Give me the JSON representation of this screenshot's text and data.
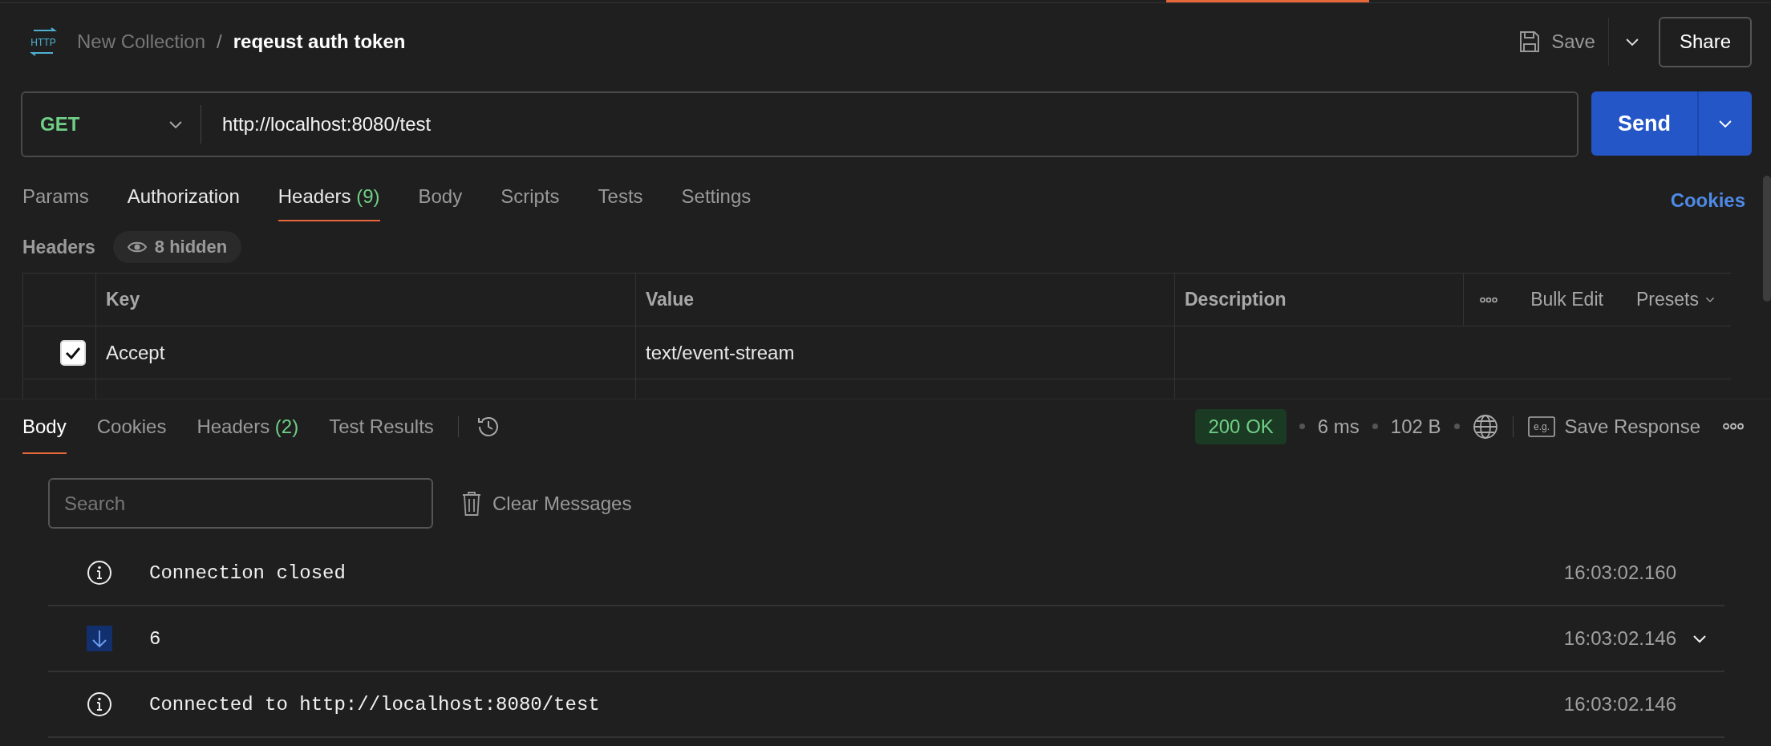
{
  "breadcrumb": {
    "icon_text": "HTTP",
    "collection": "New Collection",
    "separator": "/",
    "request": "reqeust auth token"
  },
  "toolbar": {
    "save": "Save",
    "share": "Share"
  },
  "request": {
    "method": "GET",
    "url": "http://localhost:8080/test",
    "send": "Send"
  },
  "request_tabs": [
    {
      "label": "Params",
      "selected": false,
      "has_content": false
    },
    {
      "label": "Authorization",
      "selected": false,
      "has_content": true
    },
    {
      "label": "Headers",
      "count": "(9)",
      "selected": true,
      "has_content": true
    },
    {
      "label": "Body",
      "selected": false,
      "has_content": false
    },
    {
      "label": "Scripts",
      "selected": false,
      "has_content": false
    },
    {
      "label": "Tests",
      "selected": false,
      "has_content": false
    },
    {
      "label": "Settings",
      "selected": false,
      "has_content": false
    }
  ],
  "cookies_link": "Cookies",
  "headers": {
    "title": "Headers",
    "hidden_badge": "8 hidden",
    "columns": [
      "Key",
      "Value",
      "Description"
    ],
    "actions": [
      "Bulk Edit",
      "Presets"
    ],
    "rows": [
      {
        "checked": true,
        "key": "Accept",
        "value": "text/event-stream"
      }
    ]
  },
  "response": {
    "tabs": [
      {
        "label": "Body",
        "selected": true
      },
      {
        "label": "Cookies",
        "selected": false
      },
      {
        "label": "Headers",
        "count": "(2)",
        "selected": false
      },
      {
        "label": "Test Results",
        "selected": false
      }
    ],
    "status": "200 OK",
    "time": "6 ms",
    "size": "102 B",
    "example_icon_text": "e.g.",
    "save_response": "Save Response"
  },
  "messages": {
    "search_placeholder": "Search",
    "clear": "Clear Messages",
    "items": [
      {
        "kind": "info",
        "text": "Connection closed",
        "time": "16:03:02.160",
        "expandable": false
      },
      {
        "kind": "incoming",
        "text": "6",
        "time": "16:03:02.146",
        "expandable": true
      },
      {
        "kind": "info",
        "text": "Connected to http://localhost:8080/test",
        "time": "16:03:02.146",
        "expandable": false
      }
    ]
  }
}
